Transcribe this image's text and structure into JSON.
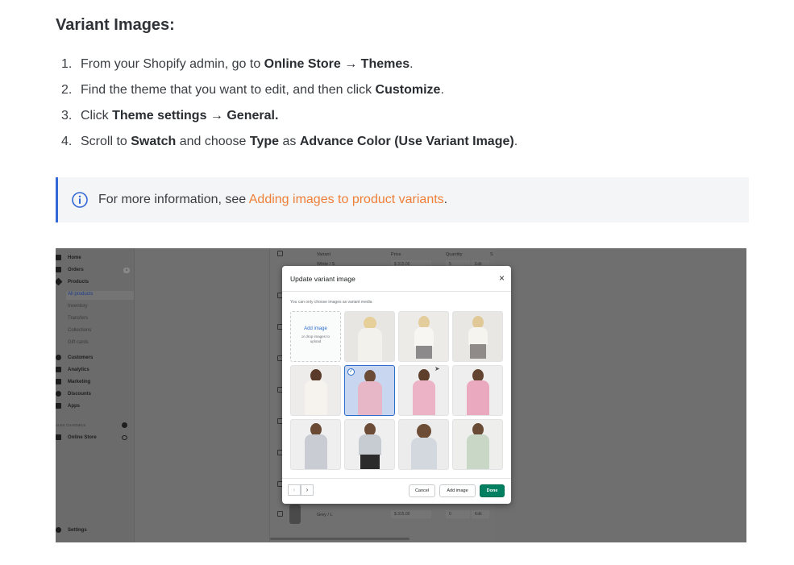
{
  "heading": "Variant Images:",
  "steps": [
    {
      "num": "1.",
      "parts": [
        {
          "t": "From your Shopify admin, go to ",
          "b": false
        },
        {
          "t": "Online Store → Themes",
          "b": true
        },
        {
          "t": ".",
          "b": false
        }
      ]
    },
    {
      "num": "2.",
      "parts": [
        {
          "t": "Find the theme that you want to edit, and then click ",
          "b": false
        },
        {
          "t": "Customize",
          "b": true
        },
        {
          "t": ".",
          "b": false
        }
      ]
    },
    {
      "num": "3.",
      "parts": [
        {
          "t": "Click ",
          "b": false
        },
        {
          "t": "Theme settings → General.",
          "b": true
        }
      ]
    },
    {
      "num": "4.",
      "parts": [
        {
          "t": "Scroll to ",
          "b": false
        },
        {
          "t": "Swatch",
          "b": true
        },
        {
          "t": " and choose ",
          "b": false
        },
        {
          "t": "Type",
          "b": true
        },
        {
          "t": " as ",
          "b": false
        },
        {
          "t": "Advance Color (Use Variant Image)",
          "b": true
        },
        {
          "t": ".",
          "b": false
        }
      ]
    }
  ],
  "note": {
    "text": "For more information, see ",
    "link": "Adding images to product variants",
    "suffix": ".",
    "icon": "info-icon"
  },
  "colors": {
    "accent_border": "#3468d6",
    "link": "#ee7f38",
    "primary_button": "#008060",
    "selection": "#2c6ecb"
  },
  "screenshot": {
    "sidebar": {
      "items": [
        {
          "label": "Home",
          "icon": "home-icon"
        },
        {
          "label": "Orders",
          "icon": "orders-icon",
          "badge": "4"
        },
        {
          "label": "Products",
          "icon": "tag-icon"
        },
        {
          "label": "All products",
          "sub": true,
          "active": true
        },
        {
          "label": "Inventory",
          "sub": true
        },
        {
          "label": "Transfers",
          "sub": true
        },
        {
          "label": "Collections",
          "sub": true
        },
        {
          "label": "Gift cards",
          "sub": true
        },
        {
          "label": "Customers",
          "icon": "person-icon"
        },
        {
          "label": "Analytics",
          "icon": "chart-icon"
        },
        {
          "label": "Marketing",
          "icon": "megaphone-icon"
        },
        {
          "label": "Discounts",
          "icon": "discount-icon"
        },
        {
          "label": "Apps",
          "icon": "apps-icon"
        }
      ],
      "channels_label": "ALES CHANNELS",
      "online_store": "Online Store",
      "settings": "Settings"
    },
    "table": {
      "headers": [
        "Variant",
        "Price",
        "Quantity",
        "S"
      ],
      "top_row": {
        "variant": "White / S",
        "price": "$ 315.00",
        "qty": "5",
        "action": "Edit"
      },
      "bottom_row": {
        "variant": "Grey / L",
        "price": "$ 315.00",
        "qty": "0",
        "action": "Edit"
      }
    },
    "modal": {
      "title": "Update variant image",
      "close": "×",
      "subtitle": "You can only choose images as variant media",
      "add_image_link": "Add image",
      "add_hint": "or drop images to upload",
      "prev": "‹",
      "next": "›",
      "cancel": "Cancel",
      "add_image_button": "Add image",
      "done": "Done"
    }
  }
}
